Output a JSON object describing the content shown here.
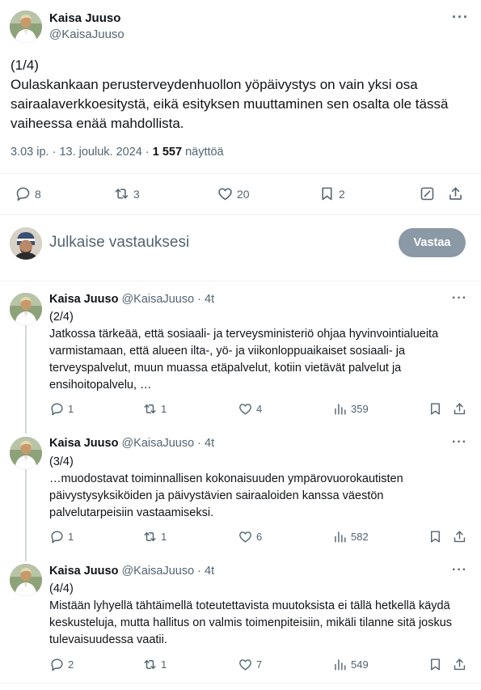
{
  "main_tweet": {
    "author_name": "Kaisa Juuso",
    "author_handle": "@KaisaJuuso",
    "more_label": "···",
    "counter": "(1/4)",
    "text": "Oulaskankaan perusterveydenhuollon yöpäivystys on vain yksi osa sairaalaverkkoesitystä, eikä esityksen muuttaminen sen osalta ole tässä vaiheessa enää mahdollista.",
    "timestamp": "3.03 ip. · 13. jouluk. 2024 ·",
    "views": "1 557",
    "views_label": "näyttöä",
    "actions": {
      "replies": "8",
      "retweets": "3",
      "likes": "20",
      "bookmarks": "2"
    }
  },
  "compose": {
    "placeholder": "Julkaise vastauksesi",
    "button_label": "Vastaa"
  },
  "replies": [
    {
      "author_name": "Kaisa Juuso",
      "author_handle": "@KaisaJuuso",
      "time": "· 4t",
      "counter": "(2/4)",
      "text": "Jatkossa tärkeää, että sosiaali- ja terveysministeriö ohjaa hyvinvointialueita varmistamaan, että alueen ilta-, yö- ja viikonloppuaikaiset sosiaali- ja terveyspalvelut, muun muassa etäpalvelut, kotiin vietävät palvelut ja ensihoitopalvelu, …",
      "replies": "1",
      "retweets": "1",
      "likes": "4",
      "views": "359"
    },
    {
      "author_name": "Kaisa Juuso",
      "author_handle": "@KaisaJuuso",
      "time": "· 4t",
      "counter": "(3/4)",
      "text": "…muodostavat toiminnallisen kokonaisuuden ympärovuorokautisten päivystysyksiköiden ja päivystävien sairaaloiden kanssa väestön palvelutarpeisiin vastaamiseksi.",
      "replies": "1",
      "retweets": "1",
      "likes": "6",
      "views": "582"
    },
    {
      "author_name": "Kaisa Juuso",
      "author_handle": "@KaisaJuuso",
      "time": "· 4t",
      "counter": "(4/4)",
      "text": "Mistään lyhyellä tähtäimellä toteutettavista muutoksista ei tällä hetkellä käydä keskusteluja, mutta hallitus on valmis toimenpiteisiin, mikäli tilanne sitä joskus tulevaisuudessa vaatii.",
      "replies": "2",
      "retweets": "1",
      "likes": "7",
      "views": "549"
    }
  ],
  "colors": {
    "text": "#0f1419",
    "muted": "#536471",
    "divider": "#eff3f4",
    "thread_line": "#cfd9de",
    "reply_button": "#8b98a5"
  },
  "icons": {
    "reply": "speech-bubble-icon",
    "retweet": "retweet-icon",
    "like": "heart-icon",
    "bookmark": "bookmark-icon",
    "share": "share-icon",
    "views": "bar-chart-icon",
    "grok": "edit-square-icon"
  }
}
